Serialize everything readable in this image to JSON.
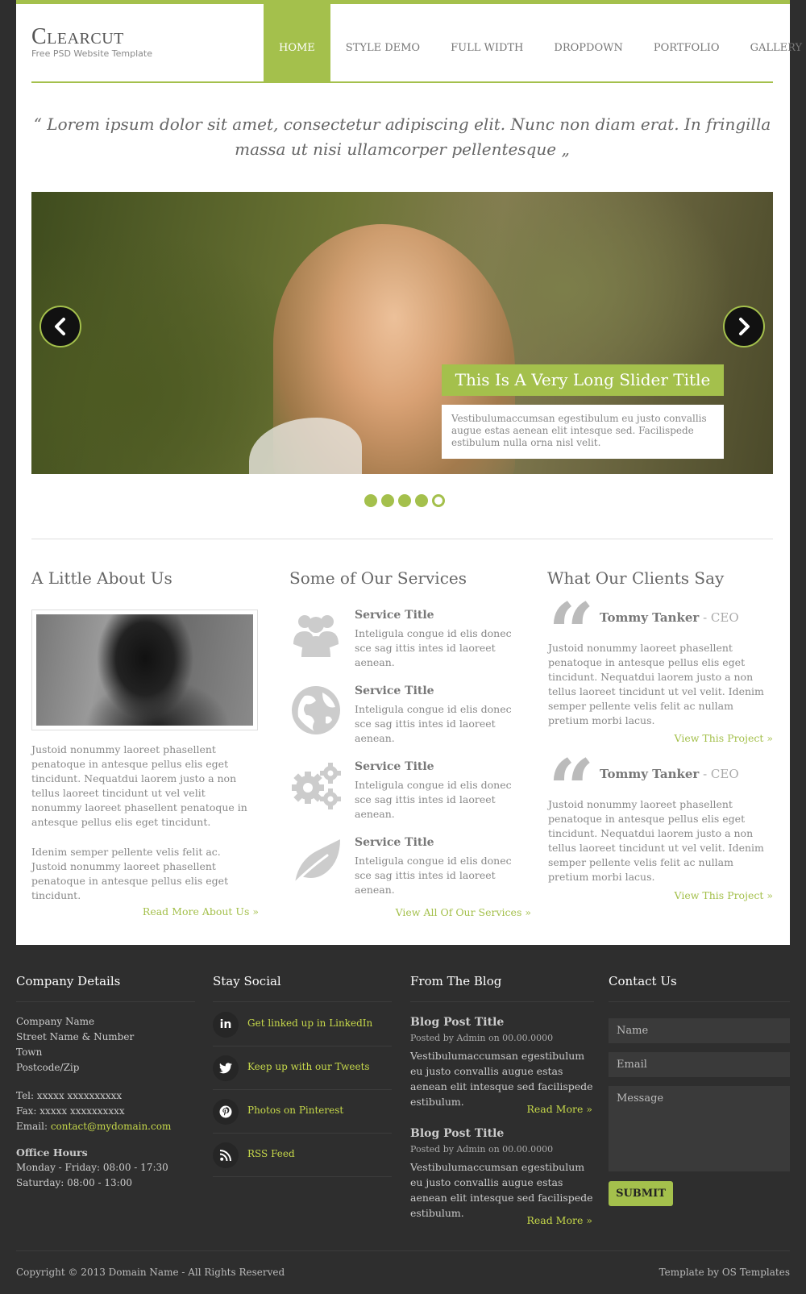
{
  "header": {
    "logo_name": "Clearcut",
    "logo_tagline": "Free PSD Website Template",
    "nav": [
      "Home",
      "Style Demo",
      "Full Width",
      "Dropdown",
      "Portfolio",
      "Gallery"
    ],
    "active_nav": "Home"
  },
  "intro_quote": "“ Lorem ipsum dolor sit amet, consectetur adipiscing elit. Nunc non diam erat. In fringilla massa ut nisi ullamcorper pellentesque „",
  "slider": {
    "title": "This Is A Very Long Slider Title",
    "text": "Vestibulumaccumsan egestibulum eu justo convallis augue estas aenean elit intesque sed. Facilispede estibulum nulla orna nisl velit.",
    "dots_total": 5,
    "active_dot": 5,
    "colors": {
      "accent": "#a4c04c"
    }
  },
  "about": {
    "title": "A Little About Us",
    "para1": "Justoid nonummy laoreet phasellent penatoque in antesque pellus elis eget tincidunt. Nequatdui laorem justo a non tellus laoreet tincidunt ut vel velit nonummy laoreet phasellent penatoque in antesque pellus elis eget tincidunt.",
    "para2": "Idenim semper pellente velis felit ac. Justoid nonummy laoreet phasellent penatoque in antesque pellus elis eget tincidunt.",
    "link": "Read More About Us »"
  },
  "services": {
    "title": "Some of Our Services",
    "items": [
      {
        "icon": "users-icon",
        "title": "Service Title",
        "text": "Inteligula congue id elis donec sce sag ittis intes id laoreet aenean."
      },
      {
        "icon": "globe-icon",
        "title": "Service Title",
        "text": "Inteligula congue id elis donec sce sag ittis intes id laoreet aenean."
      },
      {
        "icon": "gears-icon",
        "title": "Service Title",
        "text": "Inteligula congue id elis donec sce sag ittis intes id laoreet aenean."
      },
      {
        "icon": "leaf-icon",
        "title": "Service Title",
        "text": "Inteligula congue id elis donec sce sag ittis intes id laoreet aenean."
      }
    ],
    "link": "View All Of Our Services »"
  },
  "clients": {
    "title": "What Our Clients Say",
    "items": [
      {
        "name": "Tommy Tanker",
        "role": " - CEO",
        "text": "Justoid nonummy laoreet phasellent penatoque in antesque pellus elis eget tincidunt. Nequatdui laorem justo a non tellus laoreet tincidunt ut vel velit. Idenim semper pellente velis felit ac nullam pretium morbi lacus.",
        "link": "View This Project »"
      },
      {
        "name": "Tommy Tanker",
        "role": " - CEO",
        "text": "Justoid nonummy laoreet phasellent penatoque in antesque pellus elis eget tincidunt. Nequatdui laorem justo a non tellus laoreet tincidunt ut vel velit. Idenim semper pellente velis felit ac nullam pretium morbi lacus.",
        "link": "View This Project »"
      }
    ]
  },
  "footer": {
    "company": {
      "title": "Company Details",
      "address": [
        "Company Name",
        "Street Name & Number",
        "Town",
        "Postcode/Zip"
      ],
      "tel": "Tel: xxxxx xxxxxxxxxx",
      "fax": "Fax: xxxxx xxxxxxxxxx",
      "email_label": "Email: ",
      "email": "contact@mydomain.com",
      "hours_title": "Office Hours",
      "hours": [
        "Monday - Friday: 08:00 - 17:30",
        "Saturday: 08:00 - 13:00"
      ]
    },
    "social": {
      "title": "Stay Social",
      "items": [
        {
          "icon": "linkedin-icon",
          "glyph": "in",
          "label": "Get linked up in LinkedIn"
        },
        {
          "icon": "twitter-icon",
          "glyph": "t",
          "label": "Keep up with our Tweets"
        },
        {
          "icon": "pinterest-icon",
          "glyph": "p",
          "label": "Photos on Pinterest"
        },
        {
          "icon": "rss-icon",
          "glyph": "))",
          "label": "RSS Feed"
        }
      ]
    },
    "blog": {
      "title": "From The Blog",
      "posts": [
        {
          "title": "Blog Post Title",
          "meta": "Posted by Admin on 00.00.0000",
          "text": "Vestibulumaccumsan egestibulum eu justo convallis augue estas aenean elit intesque sed facilispede estibulum.",
          "more": "Read More »"
        },
        {
          "title": "Blog Post Title",
          "meta": "Posted by Admin on 00.00.0000",
          "text": "Vestibulumaccumsan egestibulum eu justo convallis augue estas aenean elit intesque sed facilispede estibulum.",
          "more": "Read More »"
        }
      ]
    },
    "contact": {
      "title": "Contact Us",
      "name_placeholder": "Name",
      "email_placeholder": "Email",
      "message_placeholder": "Message",
      "submit": "SUBMIT"
    },
    "copyright": "Copyright © 2013 Domain Name - All Rights Reserved",
    "credit": "Template by OS Templates"
  }
}
